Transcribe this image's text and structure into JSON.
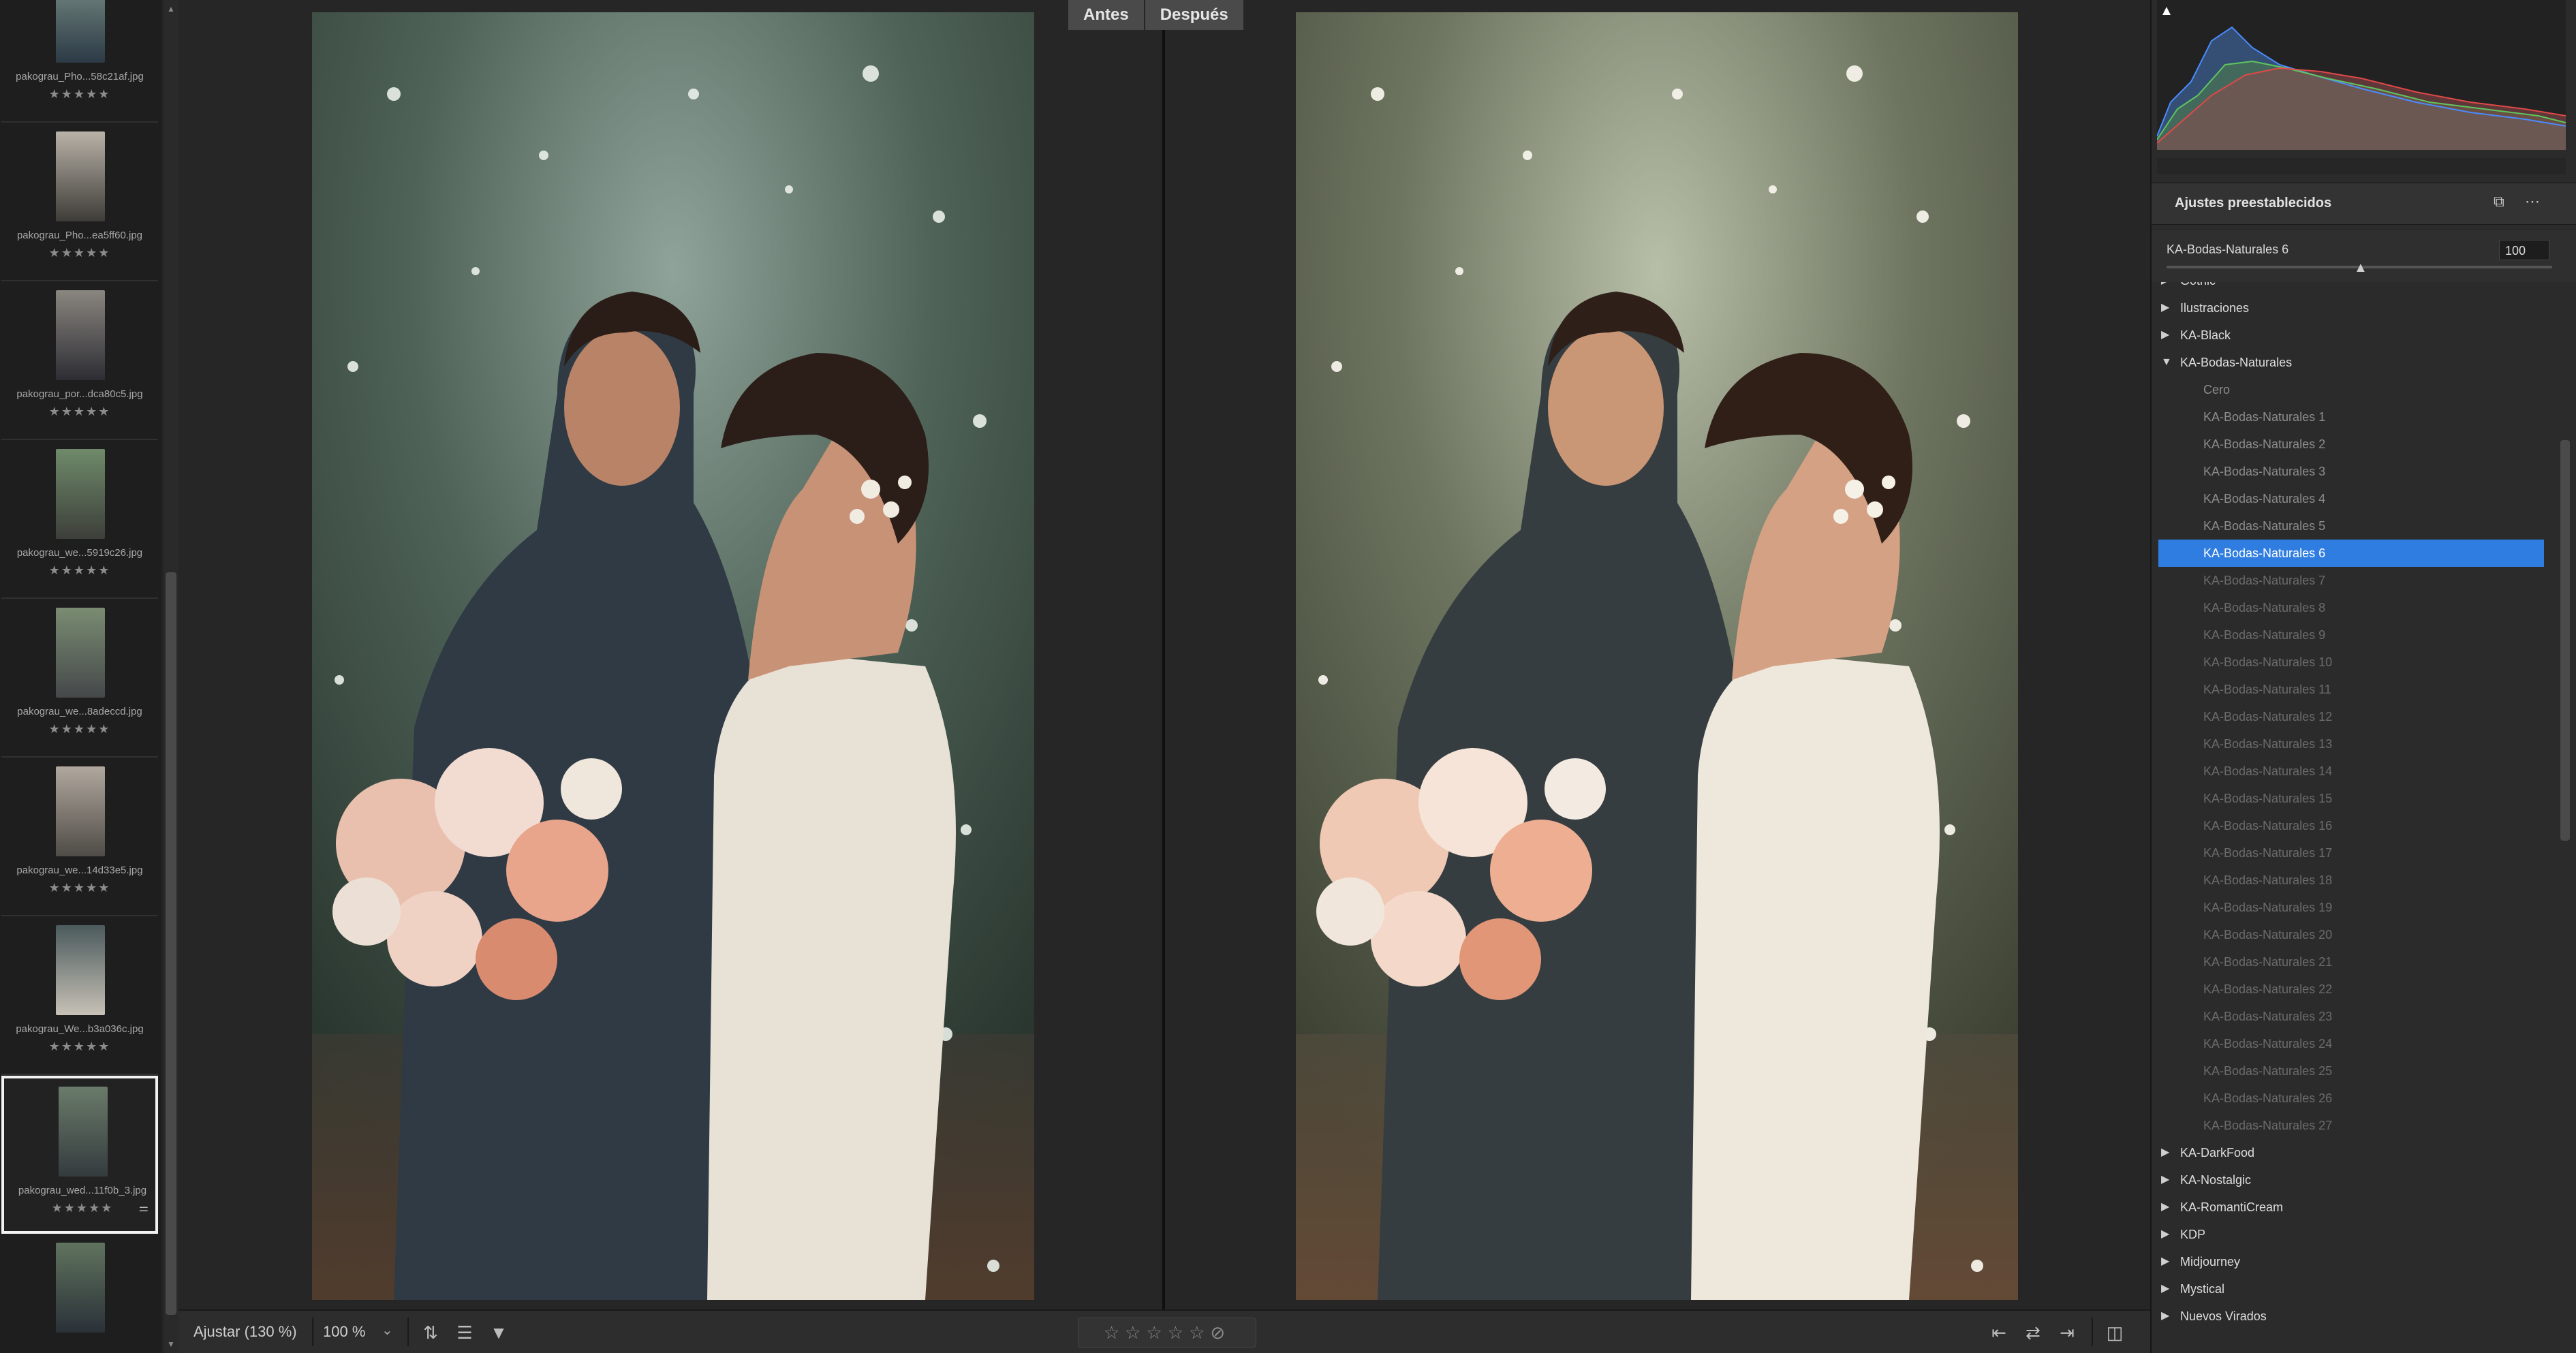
{
  "filmstrip": {
    "items": [
      {
        "name": "pakograu_Pho...58c21af.jpg",
        "stars": "★★★★★",
        "selected": false,
        "badge": ""
      },
      {
        "name": "pakograu_Pho...ea5ff60.jpg",
        "stars": "★★★★★",
        "selected": false,
        "badge": ""
      },
      {
        "name": "pakograu_por...dca80c5.jpg",
        "stars": "★★★★★",
        "selected": false,
        "badge": ""
      },
      {
        "name": "pakograu_we...5919c26.jpg",
        "stars": "★★★★★",
        "selected": false,
        "badge": ""
      },
      {
        "name": "pakograu_we...8adeccd.jpg",
        "stars": "★★★★★",
        "selected": false,
        "badge": ""
      },
      {
        "name": "pakograu_we...14d33e5.jpg",
        "stars": "★★★★★",
        "selected": false,
        "badge": ""
      },
      {
        "name": "pakograu_We...b3a036c.jpg",
        "stars": "★★★★★",
        "selected": false,
        "badge": ""
      },
      {
        "name": "pakograu_wed...11f0b_3.jpg",
        "stars": "★★★★★",
        "selected": true,
        "badge": "⚌"
      },
      {
        "name": "",
        "stars": "",
        "selected": false,
        "badge": ""
      }
    ]
  },
  "viewer": {
    "before_label": "Antes",
    "after_label": "Después"
  },
  "bottombar": {
    "fit_label": "Ajustar (130 %)",
    "zoom_value": "100 %",
    "zoom_dropdown_icon": "chevron-down-icon",
    "rating_stars": "☆☆☆☆☆",
    "rating_reject": "⊘"
  },
  "panel": {
    "presets_title": "Ajustes preestablecidos",
    "active_preset": "KA-Bodas-Naturales 6",
    "amount": "100",
    "amount_fraction": 0.5,
    "tree": [
      {
        "type": "folder",
        "label": "Gothic",
        "open": false,
        "partial": true
      },
      {
        "type": "folder",
        "label": "Ilustraciones",
        "open": false
      },
      {
        "type": "folder",
        "label": "KA-Black",
        "open": false
      },
      {
        "type": "folder",
        "label": "KA-Bodas-Naturales",
        "open": true
      },
      {
        "type": "preset",
        "label": "Cero"
      },
      {
        "type": "preset",
        "label": "KA-Bodas-Naturales 1"
      },
      {
        "type": "preset",
        "label": "KA-Bodas-Naturales 2"
      },
      {
        "type": "preset",
        "label": "KA-Bodas-Naturales 3"
      },
      {
        "type": "preset",
        "label": "KA-Bodas-Naturales 4"
      },
      {
        "type": "preset",
        "label": "KA-Bodas-Naturales 5"
      },
      {
        "type": "preset",
        "label": "KA-Bodas-Naturales 6",
        "selected": true
      },
      {
        "type": "preset",
        "label": "KA-Bodas-Naturales 7",
        "dim": true
      },
      {
        "type": "preset",
        "label": "KA-Bodas-Naturales 8",
        "dim": true
      },
      {
        "type": "preset",
        "label": "KA-Bodas-Naturales 9",
        "dim": true
      },
      {
        "type": "preset",
        "label": "KA-Bodas-Naturales 10",
        "dim": true
      },
      {
        "type": "preset",
        "label": "KA-Bodas-Naturales 11",
        "dim": true
      },
      {
        "type": "preset",
        "label": "KA-Bodas-Naturales 12",
        "dim": true
      },
      {
        "type": "preset",
        "label": "KA-Bodas-Naturales 13",
        "dim": true
      },
      {
        "type": "preset",
        "label": "KA-Bodas-Naturales 14",
        "dim": true
      },
      {
        "type": "preset",
        "label": "KA-Bodas-Naturales 15",
        "dim": true
      },
      {
        "type": "preset",
        "label": "KA-Bodas-Naturales 16",
        "dim": true
      },
      {
        "type": "preset",
        "label": "KA-Bodas-Naturales 17",
        "dim": true
      },
      {
        "type": "preset",
        "label": "KA-Bodas-Naturales 18",
        "dim": true
      },
      {
        "type": "preset",
        "label": "KA-Bodas-Naturales 19",
        "dim": true
      },
      {
        "type": "preset",
        "label": "KA-Bodas-Naturales 20",
        "dim": true
      },
      {
        "type": "preset",
        "label": "KA-Bodas-Naturales 21",
        "dim": true
      },
      {
        "type": "preset",
        "label": "KA-Bodas-Naturales 22",
        "dim": true
      },
      {
        "type": "preset",
        "label": "KA-Bodas-Naturales 23",
        "dim": true
      },
      {
        "type": "preset",
        "label": "KA-Bodas-Naturales 24",
        "dim": true
      },
      {
        "type": "preset",
        "label": "KA-Bodas-Naturales 25",
        "dim": true
      },
      {
        "type": "preset",
        "label": "KA-Bodas-Naturales 26",
        "dim": true
      },
      {
        "type": "preset",
        "label": "KA-Bodas-Naturales 27",
        "dim": true
      },
      {
        "type": "folder",
        "label": "KA-DarkFood",
        "open": false
      },
      {
        "type": "folder",
        "label": "KA-Nostalgic",
        "open": false
      },
      {
        "type": "folder",
        "label": "KA-RomantiCream",
        "open": false
      },
      {
        "type": "folder",
        "label": "KDP",
        "open": false
      },
      {
        "type": "folder",
        "label": "Midjourney",
        "open": false
      },
      {
        "type": "folder",
        "label": "Mystical",
        "open": false
      },
      {
        "type": "folder",
        "label": "Nuevos Virados",
        "open": false
      }
    ]
  },
  "colors": {
    "accent": "#2f7de0",
    "panel_bg": "#2b2b2b",
    "viewer_bg": "#262626"
  }
}
